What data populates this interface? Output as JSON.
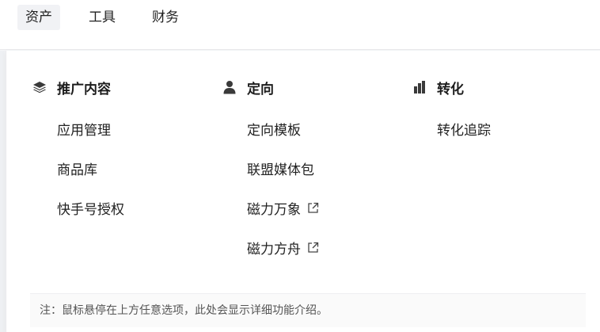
{
  "topnav": {
    "items": [
      {
        "label": "资产",
        "active": true
      },
      {
        "label": "工具",
        "active": false
      },
      {
        "label": "财务",
        "active": false
      }
    ]
  },
  "menu": {
    "columns": [
      {
        "title": "推广内容",
        "icon": "layers-icon",
        "items": [
          {
            "label": "应用管理"
          },
          {
            "label": "商品库"
          },
          {
            "label": "快手号授权"
          }
        ]
      },
      {
        "title": "定向",
        "icon": "user-icon",
        "items": [
          {
            "label": "定向模板"
          },
          {
            "label": "联盟媒体包"
          },
          {
            "label": "磁力万象",
            "external": true
          },
          {
            "label": "磁力方舟",
            "external": true
          }
        ]
      },
      {
        "title": "转化",
        "icon": "bar-chart-icon",
        "items": [
          {
            "label": "转化追踪"
          }
        ]
      }
    ],
    "note": "注：鼠标悬停在上方任意选项，此处会显示详细功能介绍。"
  },
  "colors": {
    "text": "#222222",
    "icon": "#3a3a3a",
    "active_bg": "#f1f2f5"
  }
}
